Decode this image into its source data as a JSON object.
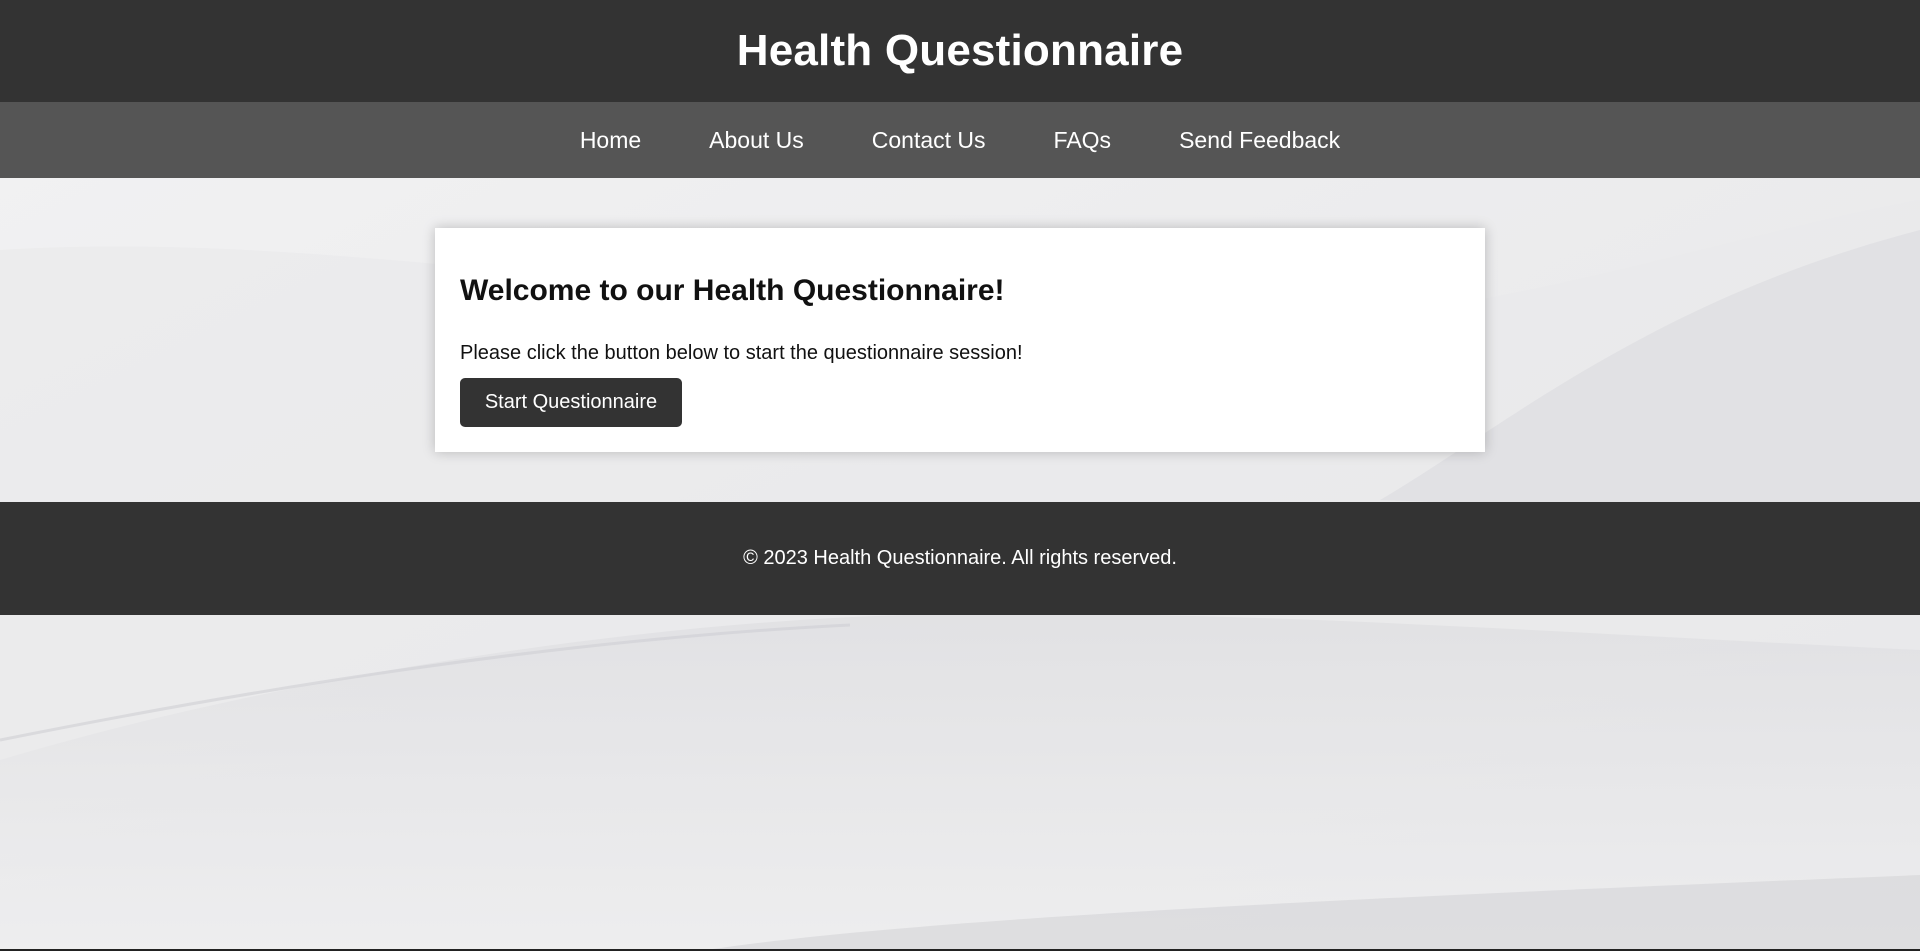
{
  "header": {
    "title": "Health Questionnaire"
  },
  "nav": {
    "items": [
      {
        "label": "Home"
      },
      {
        "label": "About Us"
      },
      {
        "label": "Contact Us"
      },
      {
        "label": "FAQs"
      },
      {
        "label": "Send Feedback"
      }
    ]
  },
  "main": {
    "heading": "Welcome to our Health Questionnaire!",
    "description": "Please click the button below to start the questionnaire session!",
    "start_button_label": "Start Questionnaire"
  },
  "footer": {
    "copyright": "© 2023 Health Questionnaire. All rights reserved."
  },
  "colors": {
    "header_bg": "#333333",
    "nav_bg": "#555555",
    "footer_bg": "#333333",
    "button_bg": "#333333",
    "text_light": "#ffffff"
  }
}
